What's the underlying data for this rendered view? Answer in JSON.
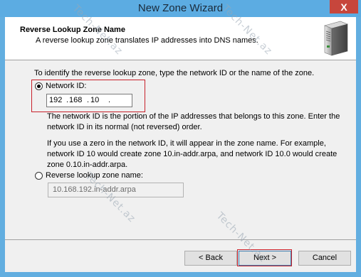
{
  "window": {
    "title": "New Zone Wizard",
    "close_glyph": "X"
  },
  "header": {
    "title": "Reverse Lookup Zone Name",
    "subtitle": "A reverse lookup zone translates IP addresses into DNS names.",
    "icon": "server-icon"
  },
  "instructions": "To identify the reverse lookup zone, type the network ID or the name of the zone.",
  "network_id": {
    "label": "Network ID:",
    "selected": true,
    "octets": [
      "192",
      "168",
      "10",
      ""
    ],
    "dot": "."
  },
  "note1_line1": "The network ID is the portion of the IP addresses that belongs to this zone. Enter the",
  "note1_line2": "network ID in its normal (not reversed) order.",
  "note2_line1": "If you use a zero in the network ID, it will appear in the zone name. For example,",
  "note2_line2": "network ID 10 would create zone 10.in-addr.arpa, and network ID 10.0 would create",
  "note2_line3": "zone 0.10.in-addr.arpa.",
  "zone_name": {
    "label": "Reverse lookup zone name:",
    "selected": false,
    "value": "10.168.192.in-addr.arpa"
  },
  "buttons": {
    "back": "< Back",
    "next": "Next >",
    "cancel": "Cancel"
  },
  "watermark": "Tech-Net.az",
  "colors": {
    "titlebar": "#5cace2",
    "close": "#c7463c",
    "highlight_box": "#c8202a"
  }
}
